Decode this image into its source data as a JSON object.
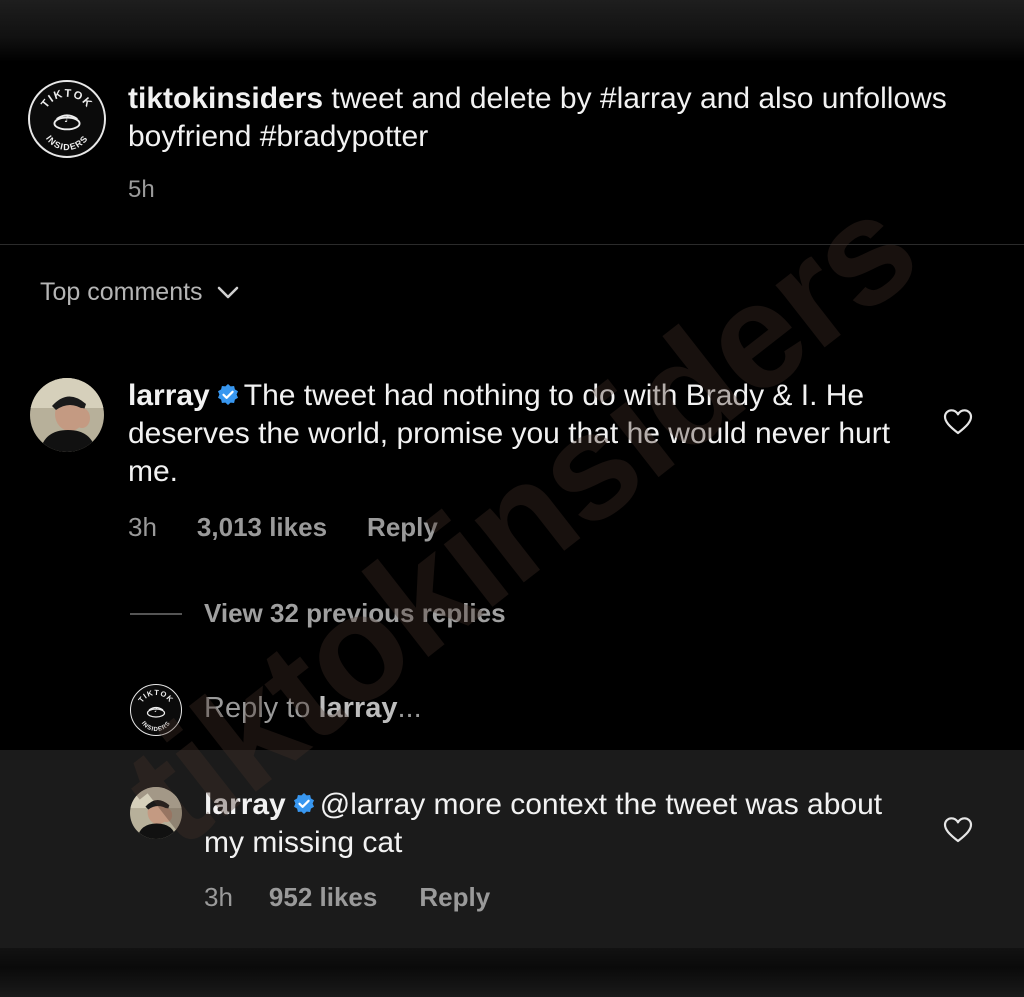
{
  "post": {
    "username": "tiktokinsiders",
    "caption": "tweet and delete by #larray and also unfollows boyfriend #bradypotter",
    "time": "5h",
    "avatar_text_top": "TIKTOK",
    "avatar_text_bottom": "INSIDERS"
  },
  "comments_header": {
    "label": "Top comments"
  },
  "comment": {
    "username": "larray",
    "text": "The tweet had nothing to do with Brady & I. He deserves the world, promise you that he would never hurt me.",
    "time": "3h",
    "likes": "3,013 likes",
    "reply_label": "Reply"
  },
  "replies": {
    "view_label": "View 32 previous replies"
  },
  "reply_input": {
    "prefix": "Reply to ",
    "target": "larray",
    "suffix": "..."
  },
  "reply": {
    "username": "larray",
    "text": "@larray more context the tweet was about my missing cat",
    "time": "3h",
    "likes": "952 likes",
    "reply_label": "Reply"
  },
  "watermark": "tiktokinsiders",
  "colors": {
    "background": "#000000",
    "verified": "#3897f0",
    "highlight": "#1b1b1b"
  }
}
